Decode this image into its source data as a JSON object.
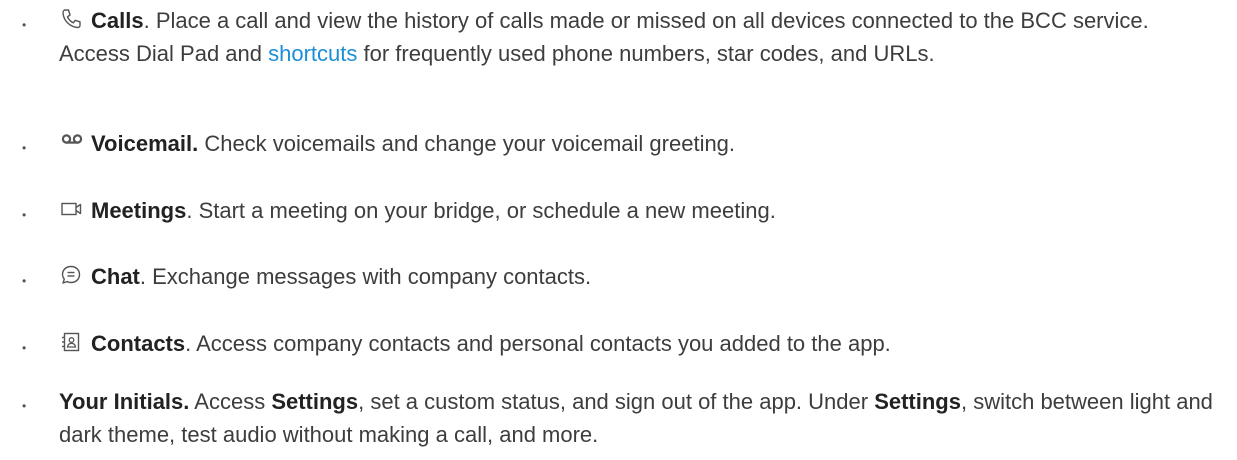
{
  "bullet_char": "•",
  "items": [
    {
      "icon": "phone-icon",
      "title": "Calls",
      "title_suffix": "",
      "text_a": ". Place a call and view the history of calls made or missed on all devices connected to the BCC service. Access Dial Pad and ",
      "link": "shortcuts",
      "text_b": " for frequently used phone numbers, star codes, and URLs."
    },
    {
      "icon": "voicemail-icon",
      "title": "Voicemail.",
      "text": " Check voicemails and change your voicemail greeting."
    },
    {
      "icon": "video-camera-icon",
      "title": "Meetings",
      "text": ". Start a meeting on your bridge, or schedule a new meeting."
    },
    {
      "icon": "chat-bubble-icon",
      "title": "Chat",
      "text": ". Exchange messages with company contacts."
    },
    {
      "icon": "contact-card-icon",
      "title": "Contacts",
      "text": ". Access company contacts and personal contacts you added to the app."
    },
    {
      "icon": "",
      "title": "Your Initials.",
      "text_a": " Access ",
      "bold_a": "Settings",
      "text_b": ", set a custom status, and sign out of the app. Under ",
      "bold_b": "Settings",
      "text_c": ", switch between light and dark theme, test audio without making a call, and more."
    }
  ],
  "colors": {
    "text": "#3d3d3d",
    "link": "#1a8fd6",
    "icon": "#555555"
  }
}
